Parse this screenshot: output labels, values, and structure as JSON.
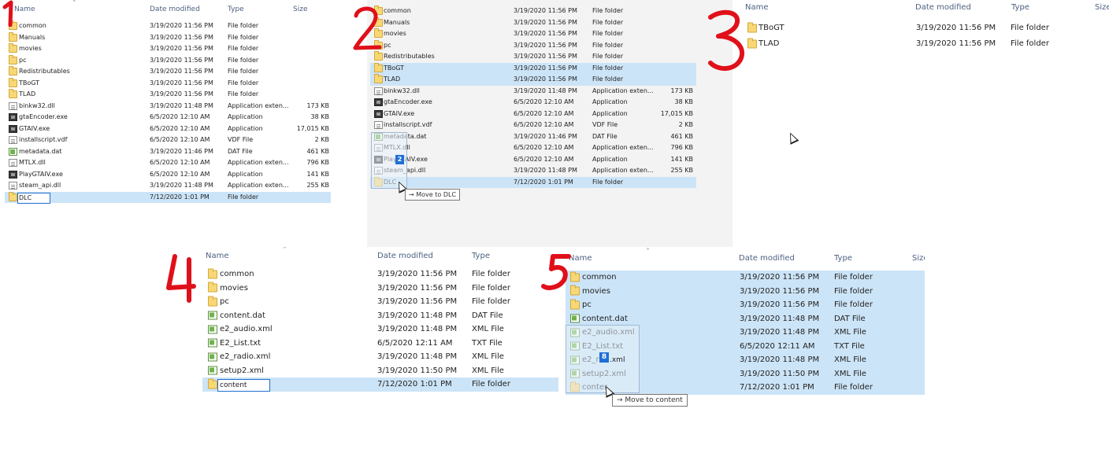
{
  "step_labels": [
    "1",
    "2",
    "3",
    "4",
    "5"
  ],
  "columns": {
    "name": "Name",
    "date": "Date modified",
    "type": "Type",
    "size": "Size"
  },
  "panel1": {
    "rows": [
      {
        "name": "common",
        "date": "3/19/2020 11:56 PM",
        "type": "File folder",
        "size": "",
        "icon": "folder"
      },
      {
        "name": "Manuals",
        "date": "3/19/2020 11:56 PM",
        "type": "File folder",
        "size": "",
        "icon": "folder"
      },
      {
        "name": "movies",
        "date": "3/19/2020 11:56 PM",
        "type": "File folder",
        "size": "",
        "icon": "folder"
      },
      {
        "name": "pc",
        "date": "3/19/2020 11:56 PM",
        "type": "File folder",
        "size": "",
        "icon": "folder"
      },
      {
        "name": "Redistributables",
        "date": "3/19/2020 11:56 PM",
        "type": "File folder",
        "size": "",
        "icon": "folder"
      },
      {
        "name": "TBoGT",
        "date": "3/19/2020 11:56 PM",
        "type": "File folder",
        "size": "",
        "icon": "folder"
      },
      {
        "name": "TLAD",
        "date": "3/19/2020 11:56 PM",
        "type": "File folder",
        "size": "",
        "icon": "folder"
      },
      {
        "name": "binkw32.dll",
        "date": "3/19/2020 11:48 PM",
        "type": "Application exten...",
        "size": "173 KB",
        "icon": "file"
      },
      {
        "name": "gtaEncoder.exe",
        "date": "6/5/2020 12:10 AM",
        "type": "Application",
        "size": "38 KB",
        "icon": "exe"
      },
      {
        "name": "GTAIV.exe",
        "date": "6/5/2020 12:10 AM",
        "type": "Application",
        "size": "17,015 KB",
        "icon": "exe"
      },
      {
        "name": "installscript.vdf",
        "date": "6/5/2020 12:10 AM",
        "type": "VDF File",
        "size": "2 KB",
        "icon": "file"
      },
      {
        "name": "metadata.dat",
        "date": "3/19/2020 11:46 PM",
        "type": "DAT File",
        "size": "461 KB",
        "icon": "dat"
      },
      {
        "name": "MTLX.dll",
        "date": "6/5/2020 12:10 AM",
        "type": "Application exten...",
        "size": "796 KB",
        "icon": "file"
      },
      {
        "name": "PlayGTAIV.exe",
        "date": "6/5/2020 12:10 AM",
        "type": "Application",
        "size": "141 KB",
        "icon": "exe"
      },
      {
        "name": "steam_api.dll",
        "date": "3/19/2020 11:48 PM",
        "type": "Application exten...",
        "size": "255 KB",
        "icon": "file"
      },
      {
        "name": "",
        "date": "7/12/2020 1:01 PM",
        "type": "File folder",
        "size": "",
        "icon": "folder",
        "selected": true
      }
    ],
    "rename_value": "DLC"
  },
  "panel2": {
    "rows": [
      {
        "name": "common",
        "date": "3/19/2020 11:56 PM",
        "type": "File folder",
        "size": "",
        "icon": "folder"
      },
      {
        "name": "Manuals",
        "date": "3/19/2020 11:56 PM",
        "type": "File folder",
        "size": "",
        "icon": "folder"
      },
      {
        "name": "movies",
        "date": "3/19/2020 11:56 PM",
        "type": "File folder",
        "size": "",
        "icon": "folder"
      },
      {
        "name": "pc",
        "date": "3/19/2020 11:56 PM",
        "type": "File folder",
        "size": "",
        "icon": "folder"
      },
      {
        "name": "Redistributables",
        "date": "3/19/2020 11:56 PM",
        "type": "File folder",
        "size": "",
        "icon": "folder"
      },
      {
        "name": "TBoGT",
        "date": "3/19/2020 11:56 PM",
        "type": "File folder",
        "size": "",
        "icon": "folder",
        "selected": true
      },
      {
        "name": "TLAD",
        "date": "3/19/2020 11:56 PM",
        "type": "File folder",
        "size": "",
        "icon": "folder",
        "selected": true
      },
      {
        "name": "binkw32.dll",
        "date": "3/19/2020 11:48 PM",
        "type": "Application exten...",
        "size": "173 KB",
        "icon": "file"
      },
      {
        "name": "gtaEncoder.exe",
        "date": "6/5/2020 12:10 AM",
        "type": "Application",
        "size": "38 KB",
        "icon": "exe"
      },
      {
        "name": "GTAIV.exe",
        "date": "6/5/2020 12:10 AM",
        "type": "Application",
        "size": "17,015 KB",
        "icon": "exe"
      },
      {
        "name": "installscript.vdf",
        "date": "6/5/2020 12:10 AM",
        "type": "VDF File",
        "size": "2 KB",
        "icon": "file"
      },
      {
        "name": "metadata.dat",
        "date": "3/19/2020 11:46 PM",
        "type": "DAT File",
        "size": "461 KB",
        "icon": "dat"
      },
      {
        "name": "MTLX.dll",
        "date": "6/5/2020 12:10 AM",
        "type": "Application exten...",
        "size": "796 KB",
        "icon": "file"
      },
      {
        "name": "PlayGTAIV.exe",
        "date": "6/5/2020 12:10 AM",
        "type": "Application",
        "size": "141 KB",
        "icon": "exe"
      },
      {
        "name": "steam_api.dll",
        "date": "3/19/2020 11:48 PM",
        "type": "Application exten...",
        "size": "255 KB",
        "icon": "file"
      },
      {
        "name": "DLC",
        "date": "7/12/2020 1:01 PM",
        "type": "File folder",
        "size": "",
        "icon": "folder",
        "selected": true
      }
    ],
    "drag_badge": "2",
    "tooltip": "Move to DLC"
  },
  "panel3": {
    "rows": [
      {
        "name": "TBoGT",
        "date": "3/19/2020 11:56 PM",
        "type": "File folder",
        "icon": "folder"
      },
      {
        "name": "TLAD",
        "date": "3/19/2020 11:56 PM",
        "type": "File folder",
        "icon": "folder"
      }
    ]
  },
  "panel4": {
    "rows": [
      {
        "name": "common",
        "date": "3/19/2020 11:56 PM",
        "type": "File folder",
        "icon": "folder"
      },
      {
        "name": "movies",
        "date": "3/19/2020 11:56 PM",
        "type": "File folder",
        "icon": "folder"
      },
      {
        "name": "pc",
        "date": "3/19/2020 11:56 PM",
        "type": "File folder",
        "icon": "folder"
      },
      {
        "name": "content.dat",
        "date": "3/19/2020 11:48 PM",
        "type": "DAT File",
        "icon": "dat"
      },
      {
        "name": "e2_audio.xml",
        "date": "3/19/2020 11:48 PM",
        "type": "XML File",
        "icon": "dat"
      },
      {
        "name": "E2_List.txt",
        "date": "6/5/2020 12:11 AM",
        "type": "TXT File",
        "icon": "dat"
      },
      {
        "name": "e2_radio.xml",
        "date": "3/19/2020 11:48 PM",
        "type": "XML File",
        "icon": "dat"
      },
      {
        "name": "setup2.xml",
        "date": "3/19/2020 11:50 PM",
        "type": "XML File",
        "icon": "dat"
      },
      {
        "name": "",
        "date": "7/12/2020 1:01 PM",
        "type": "File folder",
        "icon": "folder",
        "selected": true
      }
    ],
    "rename_value": "content"
  },
  "panel5": {
    "rows": [
      {
        "name": "common",
        "date": "3/19/2020 11:56 PM",
        "type": "File folder",
        "icon": "folder",
        "selected": true
      },
      {
        "name": "movies",
        "date": "3/19/2020 11:56 PM",
        "type": "File folder",
        "icon": "folder",
        "selected": true
      },
      {
        "name": "pc",
        "date": "3/19/2020 11:56 PM",
        "type": "File folder",
        "icon": "folder",
        "selected": true
      },
      {
        "name": "content.dat",
        "date": "3/19/2020 11:48 PM",
        "type": "DAT File",
        "icon": "dat",
        "selected": true
      },
      {
        "name": "e2_audio.xml",
        "date": "3/19/2020 11:48 PM",
        "type": "XML File",
        "icon": "dat",
        "selected": true
      },
      {
        "name": "E2_List.txt",
        "date": "6/5/2020 12:11 AM",
        "type": "TXT File",
        "icon": "dat",
        "selected": true
      },
      {
        "name": "e2_ra",
        "date": "3/19/2020 11:48 PM",
        "type": "XML File",
        "icon": "dat",
        "selected": true
      },
      {
        "name": "setup2.xml",
        "date": "3/19/2020 11:50 PM",
        "type": "XML File",
        "icon": "dat",
        "selected": true
      },
      {
        "name": "conter",
        "date": "7/12/2020 1:01 PM",
        "type": "File folder",
        "icon": "folder",
        "selected": true
      }
    ],
    "drag_badge": "8",
    "tooltip": "Move to content",
    "partial_name_suffix": ".xml"
  },
  "colors": {
    "selection": "#cce4f7",
    "annotation": "#e0101a",
    "header_text": "#4d6080",
    "rename_border": "#1f6fd1",
    "badge": "#1e6fd6"
  }
}
